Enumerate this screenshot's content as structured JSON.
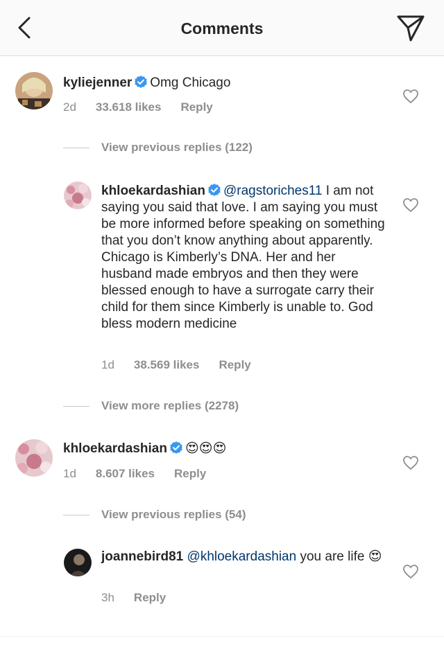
{
  "header": {
    "title": "Comments",
    "back_icon": "chevron-left-icon",
    "send_icon": "paper-plane-icon"
  },
  "colors": {
    "verified_badge": "#3897f0",
    "mention": "#00376b",
    "meta_text": "#8e8e8e",
    "header_bg": "#fafafa"
  },
  "comments": [
    {
      "username": "kyliejenner",
      "verified": true,
      "text": "Omg Chicago",
      "time": "2d",
      "likes": "33.618 likes",
      "reply_label": "Reply"
    },
    {
      "view_replies_label": "View previous replies (122)"
    },
    {
      "username": "khloekardashian",
      "verified": true,
      "mention": "@ragstoriches11",
      "text": "I am not saying you said that love. I am saying you must be more informed before speaking on something that you don’t know anything about apparently. Chicago is Kimberly’s DNA. Her and her husband made embryos and then they were blessed enough to have a surrogate carry their child for them since Kimberly is unable to. God bless modern medicine",
      "time": "1d",
      "likes": "38.569 likes",
      "reply_label": "Reply"
    },
    {
      "view_replies_label": "View more replies (2278)"
    },
    {
      "username": "khloekardashian",
      "verified": true,
      "text": "😍😍😍",
      "time": "1d",
      "likes": "8.607 likes",
      "reply_label": "Reply"
    },
    {
      "view_replies_label": "View previous replies (54)"
    },
    {
      "username": "joannebird81",
      "verified": false,
      "mention": "@khloekardashian",
      "text": "you are life 😍",
      "time": "3h",
      "reply_label": "Reply"
    }
  ]
}
